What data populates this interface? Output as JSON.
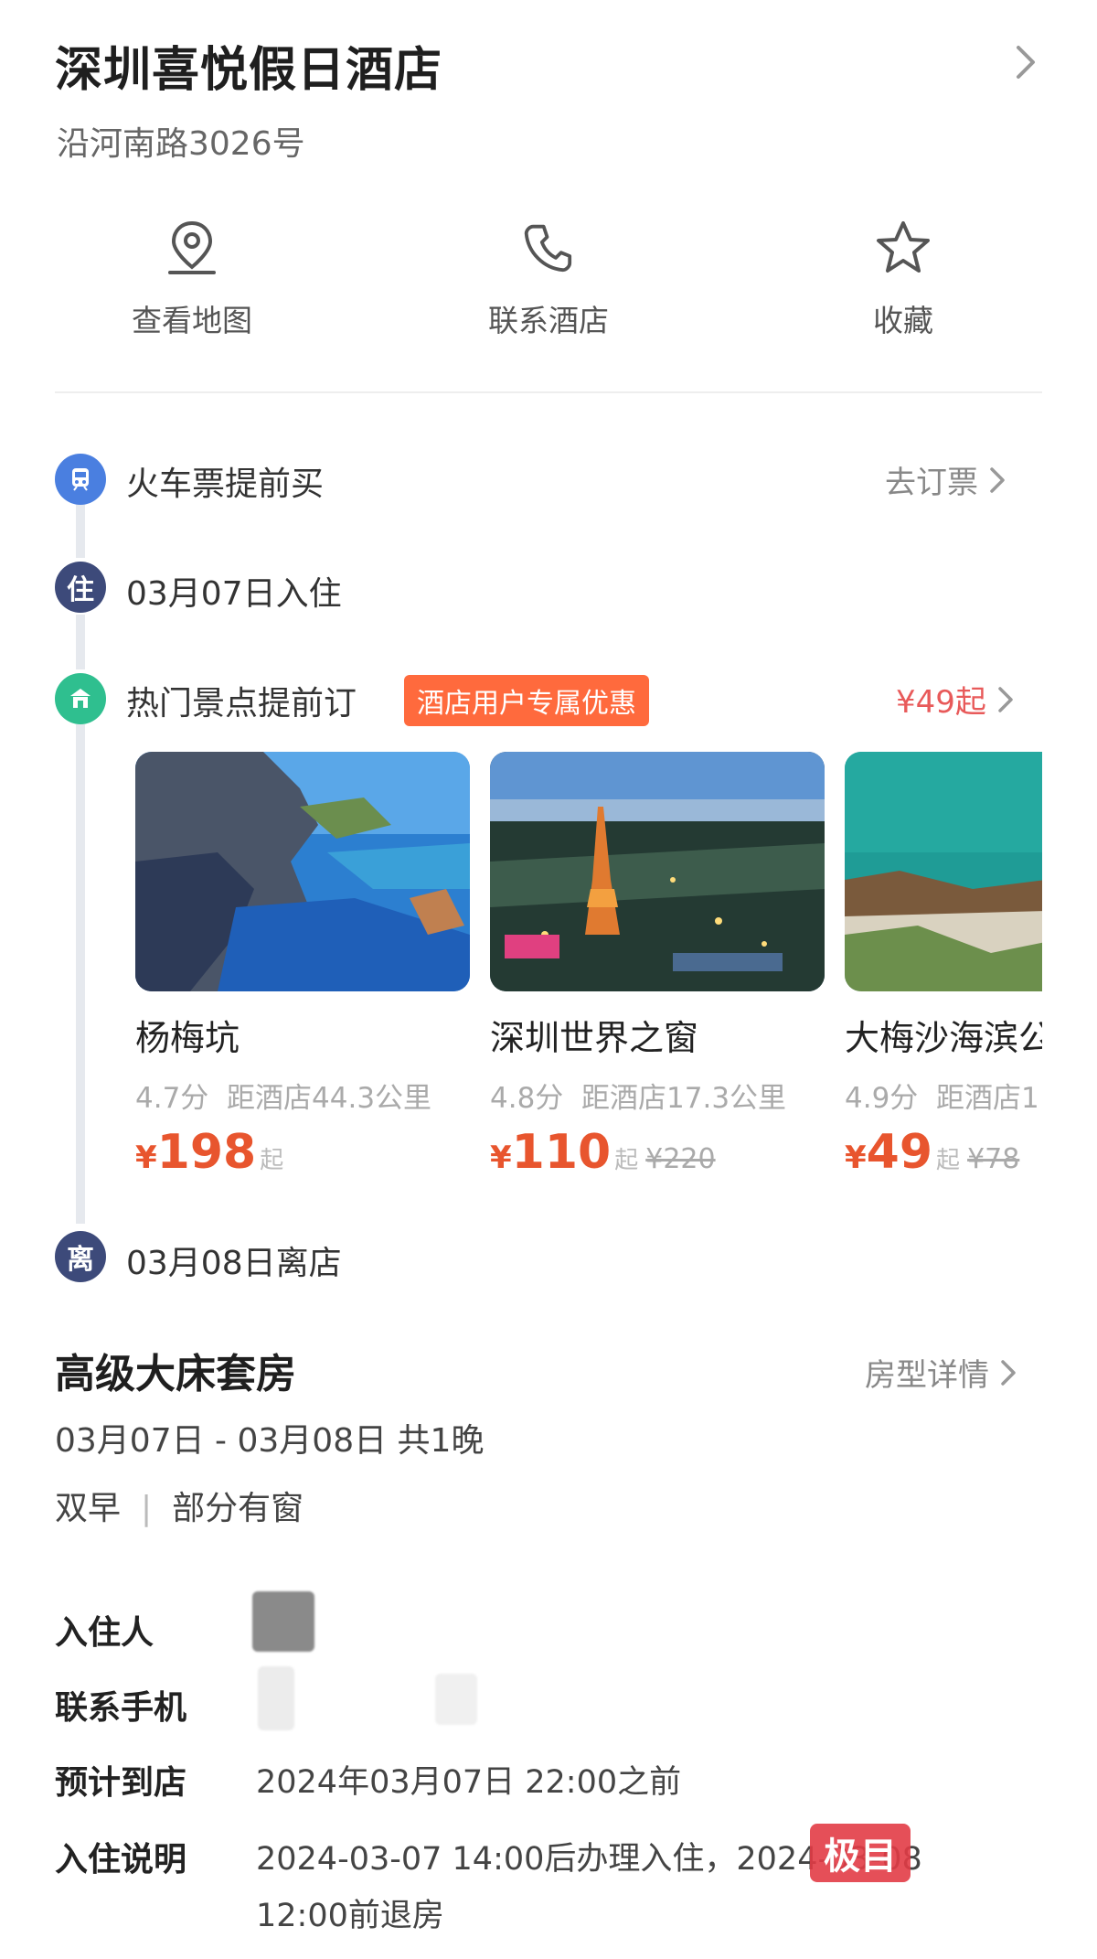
{
  "hotel": {
    "name": "深圳喜悦假日酒店",
    "address": "沿河南路3026号"
  },
  "actions": [
    {
      "label": "查看地图",
      "icon": "map-pin-icon"
    },
    {
      "label": "联系酒店",
      "icon": "phone-icon"
    },
    {
      "label": "收藏",
      "icon": "star-icon"
    }
  ],
  "timeline": {
    "train": {
      "icon_text": "🚆",
      "text": "火车票提前买",
      "link": "去订票"
    },
    "checkin": {
      "icon_text": "住",
      "text": "03月07日入住"
    },
    "attractions": {
      "icon_text": "🚌",
      "text": "热门景点提前订",
      "badge": "酒店用户专属优惠",
      "price_link": "¥49起"
    },
    "checkout": {
      "icon_text": "离",
      "text": "03月08日离店"
    }
  },
  "attraction_cards": [
    {
      "name": "杨梅坑",
      "rating": "4.7分",
      "distance": "距酒店44.3公里",
      "currency": "¥",
      "price": "198",
      "suffix": "起",
      "old_price": ""
    },
    {
      "name": "深圳世界之窗",
      "rating": "4.8分",
      "distance": "距酒店17.3公里",
      "currency": "¥",
      "price": "110",
      "suffix": "起",
      "old_price": "¥220"
    },
    {
      "name": "大梅沙海滨公",
      "rating": "4.9分",
      "distance": "距酒店1",
      "currency": "¥",
      "price": "49",
      "suffix": "起",
      "old_price": "¥78"
    }
  ],
  "room": {
    "title": "高级大床套房",
    "detail_link": "房型详情",
    "dates": "03月07日 - 03月08日  共1晚",
    "breakfast": "双早",
    "window": "部分有窗"
  },
  "info": {
    "guest_label": "入住人",
    "phone_label": "联系手机",
    "arrival_label": "预计到店",
    "arrival_value": "2024年03月07日 22:00之前",
    "notes_label": "入住说明",
    "notes_line1": "2024-03-07 14:00后办理入住，2024-03-08",
    "notes_line2": "12:00前退房"
  },
  "watermark": "极目",
  "colors": {
    "accent_orange": "#ff6a3d",
    "price_red": "#e8552e",
    "train_blue": "#4a7fe0",
    "checkin_navy": "#3d4a7a",
    "attraction_teal": "#2fbf8f"
  }
}
